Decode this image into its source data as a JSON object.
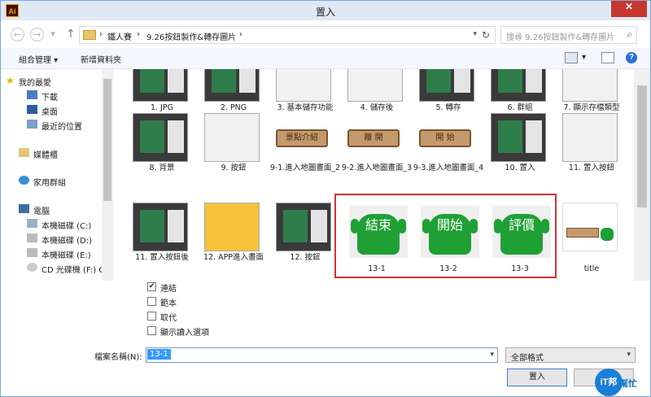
{
  "window": {
    "title": "置入",
    "app_icon": "Ai",
    "close_glyph": "✕"
  },
  "nav": {
    "breadcrumb": [
      "鐵人賽",
      "9.26按鈕製作&轉存圖片"
    ],
    "separator": "›",
    "search_placeholder": "搜尋 9.26按鈕製作&轉存圖片"
  },
  "toolbar": {
    "organize": "組合管理 ▾",
    "new_folder": "新增資料夾",
    "help": "?"
  },
  "sidebar": {
    "items": [
      {
        "label": "我的最愛",
        "icon": "star-icon"
      },
      {
        "label": "下載",
        "icon": "download-folder-icon"
      },
      {
        "label": "桌面",
        "icon": "desktop-icon"
      },
      {
        "label": "最近的位置",
        "icon": "recent-places-icon"
      },
      {
        "label": "媒體櫃",
        "icon": "library-icon"
      },
      {
        "label": "家用群組",
        "icon": "homegroup-icon"
      },
      {
        "label": "電腦",
        "icon": "computer-icon"
      },
      {
        "label": "本機磁碟 (C:)",
        "icon": "drive-icon"
      },
      {
        "label": "本機磁碟 (D:)",
        "icon": "drive-icon"
      },
      {
        "label": "本機磁碟 (E:)",
        "icon": "drive-icon"
      },
      {
        "label": "CD 光碟機 (F:) G",
        "icon": "cd-drive-icon"
      }
    ]
  },
  "files": {
    "row1": [
      "1. JPG",
      "2. PNG",
      "3. 基本儲存功能",
      "4. 儲存後",
      "5. 轉存",
      "6. 群組",
      "7. 顯示存檔類型"
    ],
    "row2": [
      "8. 背景",
      "9. 按鈕",
      "9-1.進入地圖畫面_2",
      "9-2.進入地圖畫面_3",
      "9-3.進入地圖畫面_4",
      "10. 置入",
      "11. 置入按鈕"
    ],
    "row3": [
      "11. 置入按鈕後",
      "12. APP進入畫面",
      "12. 按鈕",
      "13-1",
      "13-2",
      "13-3",
      "title"
    ],
    "wood_signs": [
      "景點介紹",
      "離 開",
      "開 始"
    ],
    "cactus_text": [
      "結束",
      "開始",
      "評價"
    ]
  },
  "options": [
    {
      "label": "連結",
      "checked": true
    },
    {
      "label": "範本",
      "checked": false
    },
    {
      "label": "取代",
      "checked": false
    },
    {
      "label": "顯示讀入選項",
      "checked": false
    }
  ],
  "filename": {
    "label": "檔案名稱(N):",
    "value": "13-1"
  },
  "format": {
    "value": "全部格式"
  },
  "buttons": {
    "place": "置入",
    "cancel": "取"
  },
  "logo": {
    "circle": "iT邦",
    "text": "幫忙"
  },
  "colors": {
    "accent": "#3399ff",
    "highlight_box": "#d43131",
    "cactus": "#1fa035",
    "close": "#c7372f"
  }
}
